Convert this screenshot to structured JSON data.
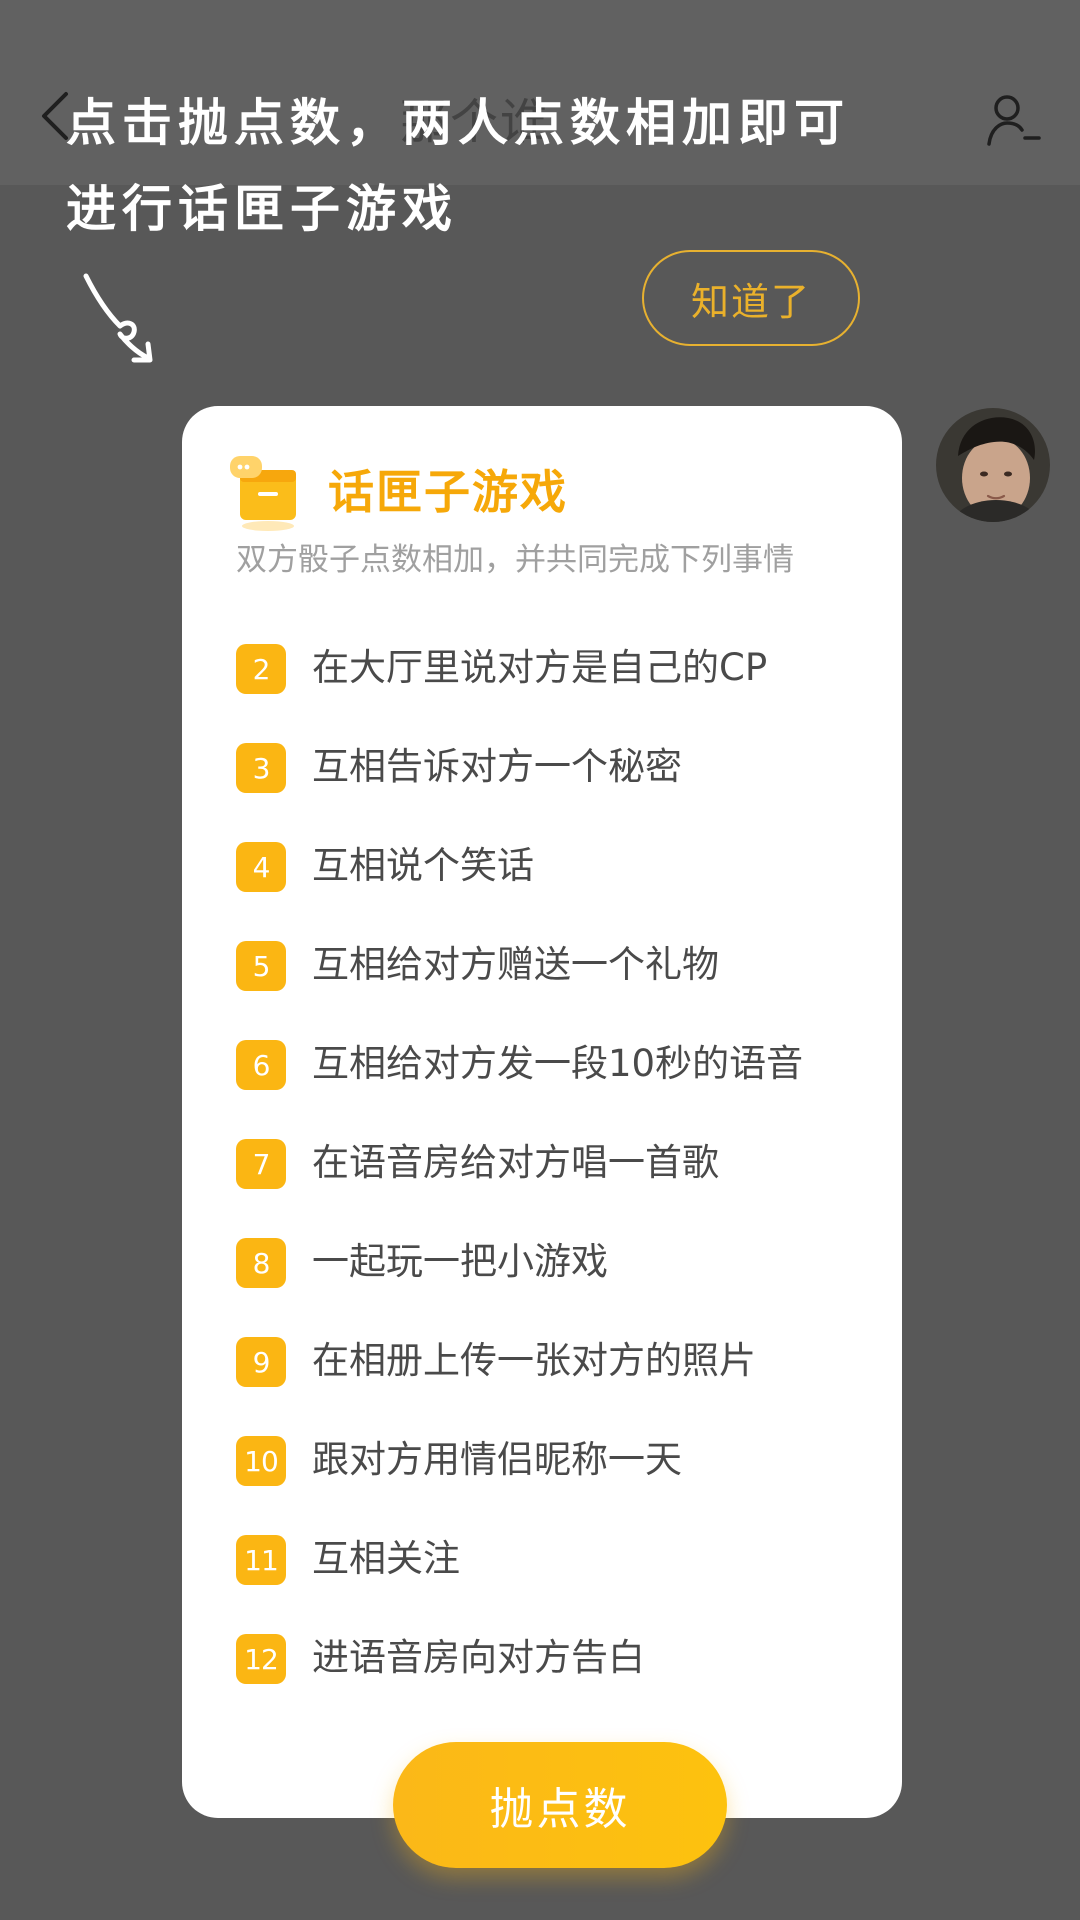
{
  "header": {
    "title": "那个谁",
    "back_icon": "chevron-left-icon",
    "profile_icon": "user-minus-icon"
  },
  "hint": {
    "line1": "点击抛点数，两人点数相加即可",
    "line2": "进行话匣子游戏",
    "dismiss_label": "知道了"
  },
  "card": {
    "title": "话匣子游戏",
    "subtitle": "双方骰子点数相加，并共同完成下列事情",
    "rules": [
      {
        "number": "2",
        "text": "在大厅里说对方是自己的CP"
      },
      {
        "number": "3",
        "text": "互相告诉对方一个秘密"
      },
      {
        "number": "4",
        "text": "互相说个笑话"
      },
      {
        "number": "5",
        "text": "互相给对方赠送一个礼物"
      },
      {
        "number": "6",
        "text": "互相给对方发一段10秒的语音"
      },
      {
        "number": "7",
        "text": "在语音房给对方唱一首歌"
      },
      {
        "number": "8",
        "text": "一起玩一把小游戏"
      },
      {
        "number": "9",
        "text": "在相册上传一张对方的照片"
      },
      {
        "number": "10",
        "text": "跟对方用情侣昵称一天"
      },
      {
        "number": "11",
        "text": "互相关注"
      },
      {
        "number": "12",
        "text": "进语音房向对方告白"
      }
    ],
    "roll_label": "抛点数"
  },
  "colors": {
    "accent": "#fbb613",
    "overlay": "#585858",
    "title": "#f6a809"
  }
}
